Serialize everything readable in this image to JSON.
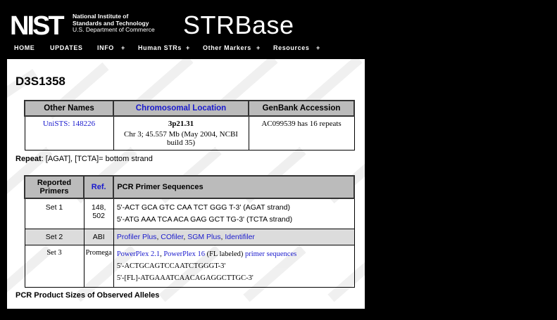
{
  "brand": {
    "logo_text": "NIST",
    "agency_line1": "National Institute of",
    "agency_line2": "Standards and Technology",
    "agency_line3": "U.S. Department of Commerce",
    "site_title": "STRBase"
  },
  "nav": {
    "items": [
      {
        "label": "HOME"
      },
      {
        "label": "UPDATES"
      },
      {
        "label": "INFO",
        "plus": "+"
      },
      {
        "label": "Human STRs",
        "plus": "+"
      },
      {
        "label": "Other Markers",
        "plus": "+"
      },
      {
        "label": "Resources",
        "plus": "+"
      }
    ]
  },
  "page": {
    "title": "D3S1358",
    "overview": {
      "headers": [
        "Other Names",
        "Chromosomal Location",
        "GenBank Accession"
      ],
      "other_names": "UniSTS: 148226",
      "location_band": "3p21.31",
      "location_detail": "Chr 3; 45.557 Mb (May 2004, NCBI build 35)",
      "genbank": "AC099539 has 16 repeats"
    },
    "repeat_label": "Repeat",
    "repeat_text": ": [AGAT], [TCTA]= bottom strand",
    "primers": {
      "headers": [
        "Reported Primers",
        "Ref.",
        "PCR Primer Sequences"
      ],
      "set1": {
        "name": "Set 1",
        "ref": "148, 502",
        "seq1": "5'-ACT GCA GTC CAA TCT GGG T-3' (AGAT strand)",
        "seq2": "5'-ATG AAA TCA ACA GAG GCT TG-3' (TCTA strand)"
      },
      "set2": {
        "name": "Set 2",
        "ref": "ABI",
        "links": [
          "Profiler Plus",
          "COfiler",
          "SGM Plus",
          "Identifiler"
        ]
      },
      "set3": {
        "name": "Set 3",
        "ref": "Promega",
        "link1": "PowerPlex 2.1",
        "link2": "PowerPlex 16",
        "label_text": "(FL labeled)",
        "link3": "primer sequences",
        "seq1": "5'-ACTGCAGTCCAATCTGGGT-3'",
        "seq2": "5'-[FL]-ATGAAATCAACAGAGGCTTGC-3'"
      }
    },
    "section_heading": "PCR Product Sizes of Observed Alleles"
  },
  "colors": {
    "link": "#1a1acd",
    "header_bg": "#bbbbbb",
    "page_bg": "#000000"
  }
}
